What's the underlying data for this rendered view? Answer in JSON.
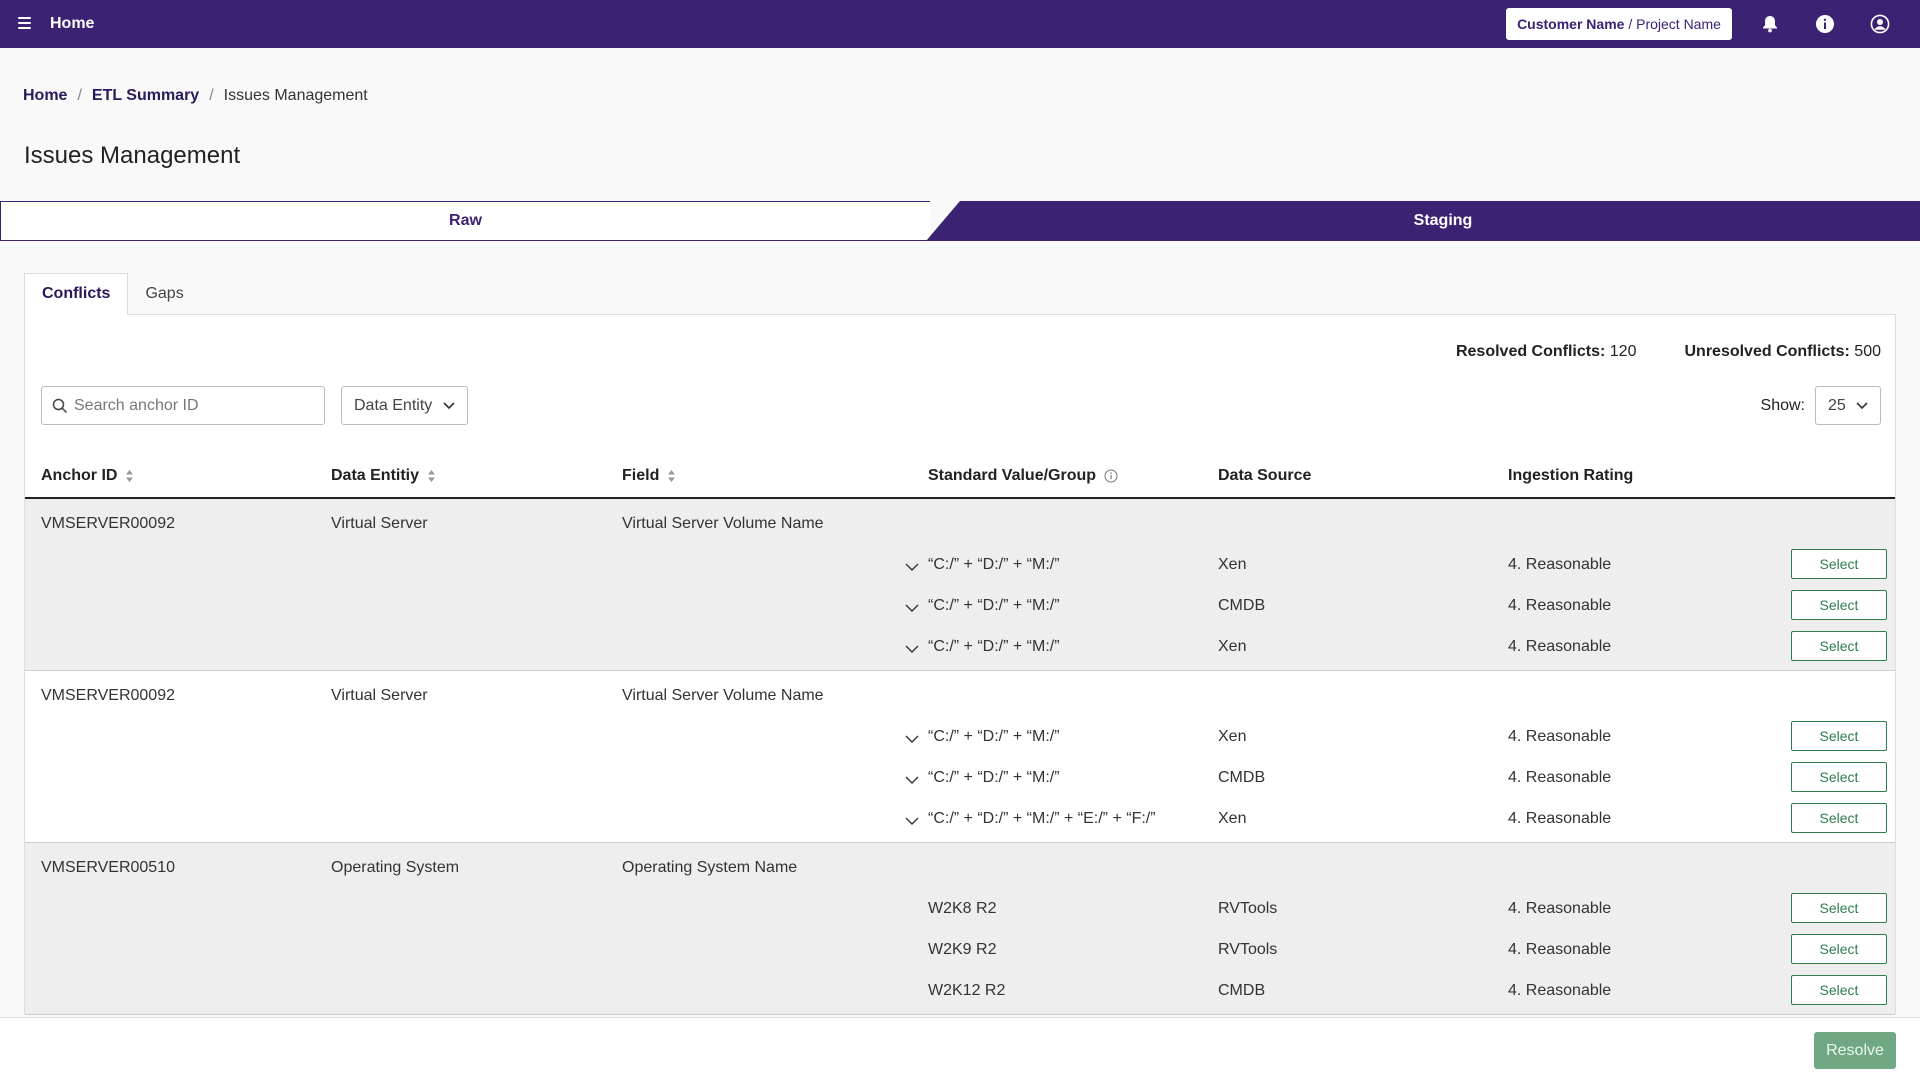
{
  "topbar": {
    "title": "Home",
    "customer_name": "Customer Name",
    "project_sep": " / ",
    "project_name": "Project Name"
  },
  "breadcrumb": {
    "items": [
      "Home",
      "ETL Summary"
    ],
    "separator": "/",
    "current": "Issues Management"
  },
  "page": {
    "title": "Issues Management"
  },
  "stepper": {
    "raw": "Raw",
    "staging": "Staging"
  },
  "tabs": [
    "Conflicts",
    "Gaps"
  ],
  "counts": {
    "resolved_label": "Resolved Conflicts:",
    "resolved_value": "120",
    "unresolved_label": "Unresolved Conflicts:",
    "unresolved_value": "500"
  },
  "filters": {
    "search_placeholder": "Search anchor ID",
    "entity_dropdown": "Data Entity",
    "show_label": "Show:",
    "show_value": "25"
  },
  "table": {
    "headers": {
      "anchor_id": "Anchor ID",
      "data_entity": "Data Entitiy",
      "field": "Field",
      "standard_value": "Standard Value/Group",
      "data_source": "Data Source",
      "ingestion_rating": "Ingestion Rating"
    },
    "select_label": "Select",
    "groups": [
      {
        "anchor_id": "VMSERVER00092",
        "data_entity": "Virtual Server",
        "field": "Virtual Server Volume Name",
        "rows": [
          {
            "value": "“C:/” + “D:/” + “M:/”",
            "source": "Xen",
            "rating": "4. Reasonable"
          },
          {
            "value": "“C:/” + “D:/” + “M:/”",
            "source": "CMDB",
            "rating": "4. Reasonable"
          },
          {
            "value": "“C:/” + “D:/” + “M:/”",
            "source": "Xen",
            "rating": "4. Reasonable"
          }
        ]
      },
      {
        "anchor_id": "VMSERVER00092",
        "data_entity": "Virtual Server",
        "field": "Virtual Server Volume Name",
        "rows": [
          {
            "value": "“C:/” + “D:/” + “M:/”",
            "source": "Xen",
            "rating": "4. Reasonable"
          },
          {
            "value": "“C:/” + “D:/” + “M:/”",
            "source": "CMDB",
            "rating": "4. Reasonable"
          },
          {
            "value": "“C:/” + “D:/” + “M:/” + “E:/” + “F:/”",
            "source": "Xen",
            "rating": "4. Reasonable"
          }
        ]
      },
      {
        "anchor_id": "VMSERVER00510",
        "data_entity": "Operating System",
        "field": "Operating System Name",
        "rows": [
          {
            "value": "W2K8 R2",
            "source": "RVTools",
            "rating": "4. Reasonable"
          },
          {
            "value": "W2K9 R2",
            "source": "RVTools",
            "rating": "4. Reasonable"
          },
          {
            "value": "W2K12 R2",
            "source": "CMDB",
            "rating": "4. Reasonable"
          }
        ]
      }
    ]
  },
  "footer": {
    "resolve_label": "Resolve"
  },
  "colors": {
    "brand": "#3c2272",
    "success": "#2e7d4f",
    "resolve": "#6fa882"
  }
}
